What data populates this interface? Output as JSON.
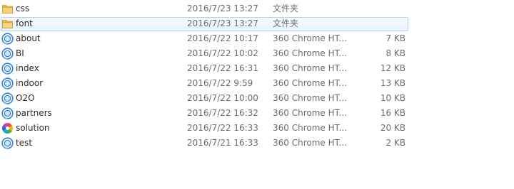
{
  "files": [
    {
      "name": "css",
      "modified": "2016/7/23 13:27",
      "type": "文件夹",
      "size": "",
      "icon": "folder-icon",
      "hover": false
    },
    {
      "name": "font",
      "modified": "2016/7/23 13:27",
      "type": "文件夹",
      "size": "",
      "icon": "folder-icon",
      "hover": true
    },
    {
      "name": "about",
      "modified": "2016/7/22 10:17",
      "type": "360 Chrome HT...",
      "size": "7 KB",
      "icon": "browser-html-icon",
      "hover": false
    },
    {
      "name": "BI",
      "modified": "2016/7/22 10:02",
      "type": "360 Chrome HT...",
      "size": "8 KB",
      "icon": "browser-html-icon",
      "hover": false
    },
    {
      "name": "index",
      "modified": "2016/7/22 16:31",
      "type": "360 Chrome HT...",
      "size": "12 KB",
      "icon": "browser-html-icon",
      "hover": false
    },
    {
      "name": "indoor",
      "modified": "2016/7/22 9:59",
      "type": "360 Chrome HT...",
      "size": "13 KB",
      "icon": "browser-html-icon",
      "hover": false
    },
    {
      "name": "O2O",
      "modified": "2016/7/22 10:00",
      "type": "360 Chrome HT...",
      "size": "10 KB",
      "icon": "browser-html-icon",
      "hover": false
    },
    {
      "name": "partners",
      "modified": "2016/7/22 16:32",
      "type": "360 Chrome HT...",
      "size": "16 KB",
      "icon": "browser-html-icon",
      "hover": false
    },
    {
      "name": "solution",
      "modified": "2016/7/22 16:33",
      "type": "360 Chrome HT...",
      "size": "20 KB",
      "icon": "color-wheel-icon",
      "hover": false
    },
    {
      "name": "test",
      "modified": "2016/7/21 16:33",
      "type": "360 Chrome HT...",
      "size": "2 KB",
      "icon": "browser-html-icon",
      "hover": false
    }
  ],
  "colors": {
    "folder": "#e9b84a",
    "browser_blue": "#2f7fd6",
    "hover_border": "#b6d4f0"
  }
}
